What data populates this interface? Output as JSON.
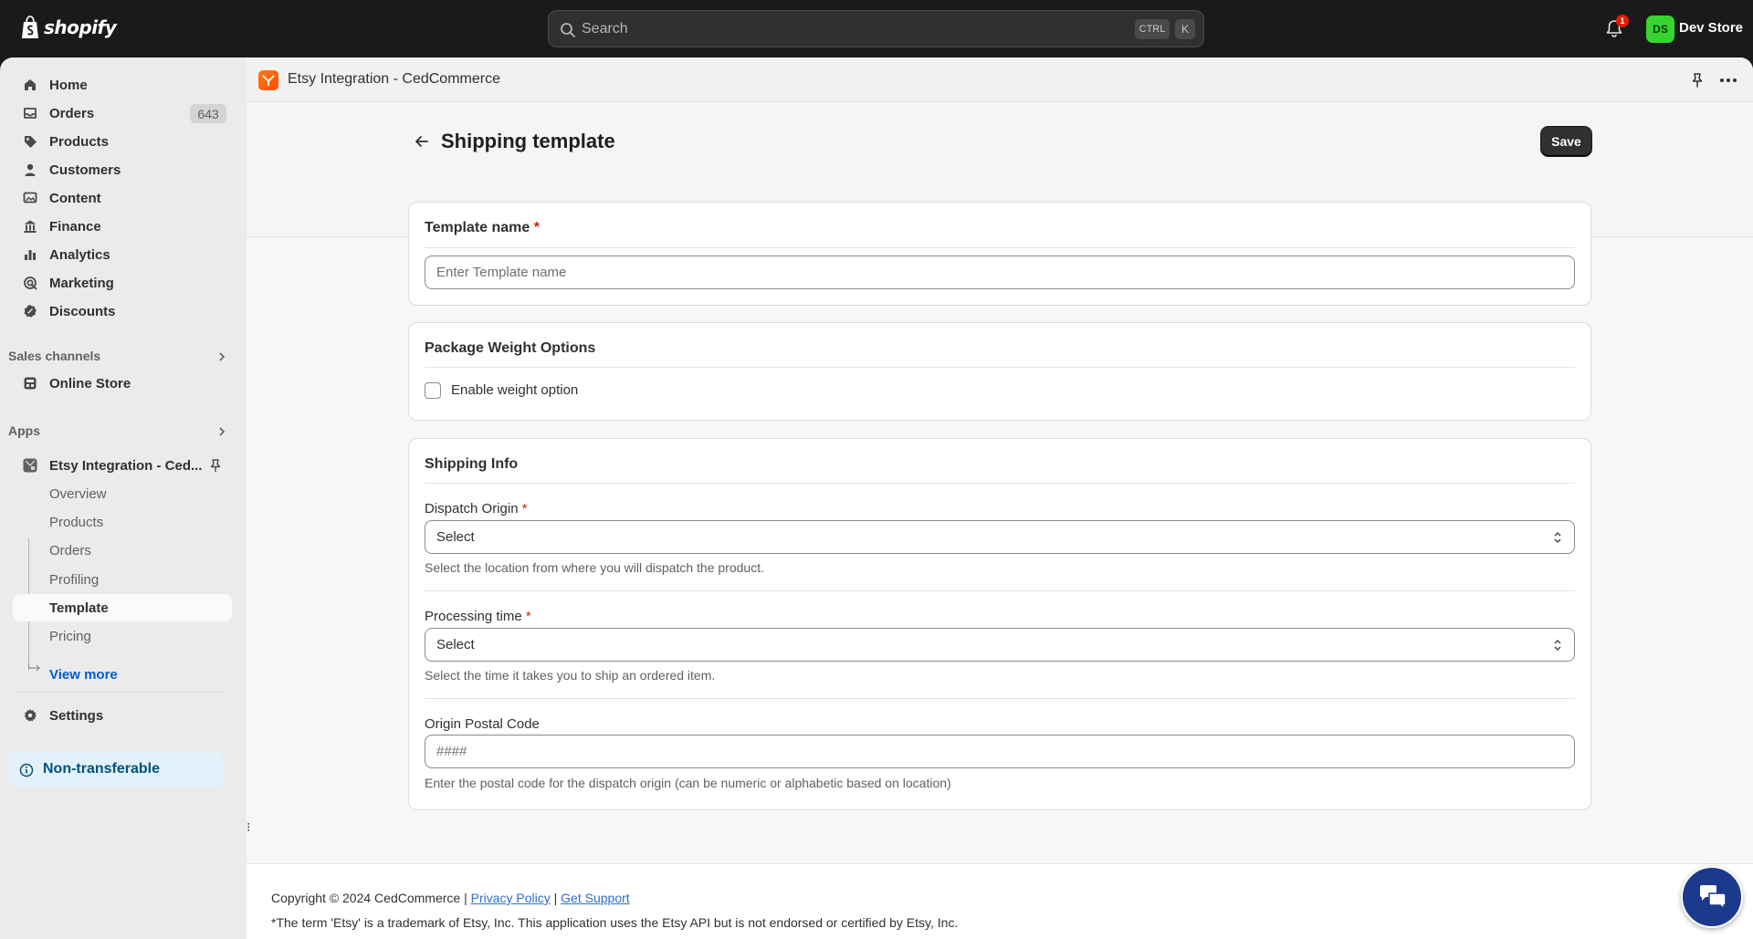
{
  "topbar": {
    "logo_text": "shopify",
    "search_placeholder": "Search",
    "shortcut_ctrl": "CTRL",
    "shortcut_k": "K",
    "notification_count": "1",
    "avatar_initials": "DS",
    "store_name": "Dev Store"
  },
  "sidebar": {
    "nav": [
      {
        "label": "Home",
        "icon": "home-icon"
      },
      {
        "label": "Orders",
        "icon": "orders-icon",
        "count": "643"
      },
      {
        "label": "Products",
        "icon": "tag-icon"
      },
      {
        "label": "Customers",
        "icon": "person-icon"
      },
      {
        "label": "Content",
        "icon": "content-icon"
      },
      {
        "label": "Finance",
        "icon": "bank-icon"
      },
      {
        "label": "Analytics",
        "icon": "bar-chart-icon"
      },
      {
        "label": "Marketing",
        "icon": "target-icon"
      },
      {
        "label": "Discounts",
        "icon": "discount-icon"
      }
    ],
    "sales_channels_label": "Sales channels",
    "online_store_label": "Online Store",
    "apps_label": "Apps",
    "app_name": "Etsy Integration - Ced...",
    "app_subitems": [
      "Overview",
      "Products",
      "Orders",
      "Profiling",
      "Template",
      "Pricing"
    ],
    "active_subitem": "Template",
    "view_more": "View more",
    "settings_label": "Settings",
    "non_transferable": "Non-transferable"
  },
  "app_header": {
    "title": "Etsy Integration - CedCommerce"
  },
  "page": {
    "title": "Shipping template",
    "save_label": "Save"
  },
  "template_card": {
    "label": "Template name",
    "required_mark": "*",
    "placeholder": "Enter Template name"
  },
  "weight_card": {
    "title": "Package Weight Options",
    "checkbox_label": "Enable weight option",
    "checked": false
  },
  "shipping_card": {
    "title": "Shipping Info",
    "dispatch_label": "Dispatch Origin",
    "dispatch_value": "Select",
    "dispatch_help": "Select the location from where you will dispatch the product.",
    "processing_label": "Processing time",
    "processing_value": "Select",
    "processing_help": "Select the time it takes you to ship an ordered item.",
    "postal_label": "Origin Postal Code",
    "postal_placeholder": "####",
    "postal_help": "Enter the postal code for the dispatch origin (can be numeric or alphabetic based on location)"
  },
  "footer": {
    "copyright": "Copyright © 2024 CedCommerce |",
    "privacy": "Privacy Policy",
    "separator": "|",
    "support": "Get Support",
    "trademark": "*The term 'Etsy' is a trademark of Etsy, Inc. This application uses the Etsy API but is not endorsed or certified by Etsy, Inc."
  },
  "colors": {
    "topbar_bg": "#1a1a1a",
    "sidebar_bg": "#ebebeb",
    "accent_link": "#005bd3",
    "avatar_bg": "#36d52f",
    "save_button_bg": "#303030",
    "info_bg": "#e3f1fa",
    "chat_bg": "#1b3a8c"
  }
}
